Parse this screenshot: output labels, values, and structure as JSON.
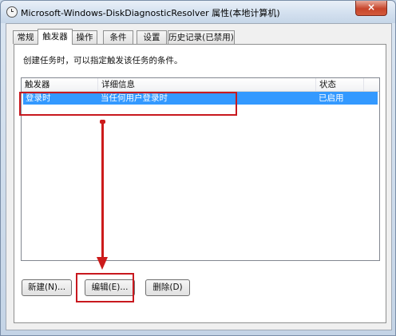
{
  "window": {
    "title": "Microsoft-Windows-DiskDiagnosticResolver 属性(本地计算机)",
    "close_label": "×"
  },
  "tabs": [
    {
      "label": "常规"
    },
    {
      "label": "触发器"
    },
    {
      "label": "操作"
    },
    {
      "label": "条件"
    },
    {
      "label": "设置"
    },
    {
      "label": "历史记录(已禁用)"
    }
  ],
  "active_tab": "触发器",
  "description": "创建任务时，可以指定触发该任务的条件。",
  "list": {
    "columns": [
      "触发器",
      "详细信息",
      "状态"
    ],
    "rows": [
      {
        "trigger": "登录时",
        "details": "当任何用户登录时",
        "status": "已启用",
        "selected": true
      }
    ]
  },
  "buttons": {
    "new_label": "新建(N)...",
    "edit_label": "编辑(E)...",
    "delete_label": "删除(D)"
  },
  "colors": {
    "selection": "#3399ff",
    "annotation": "#c8181e"
  }
}
